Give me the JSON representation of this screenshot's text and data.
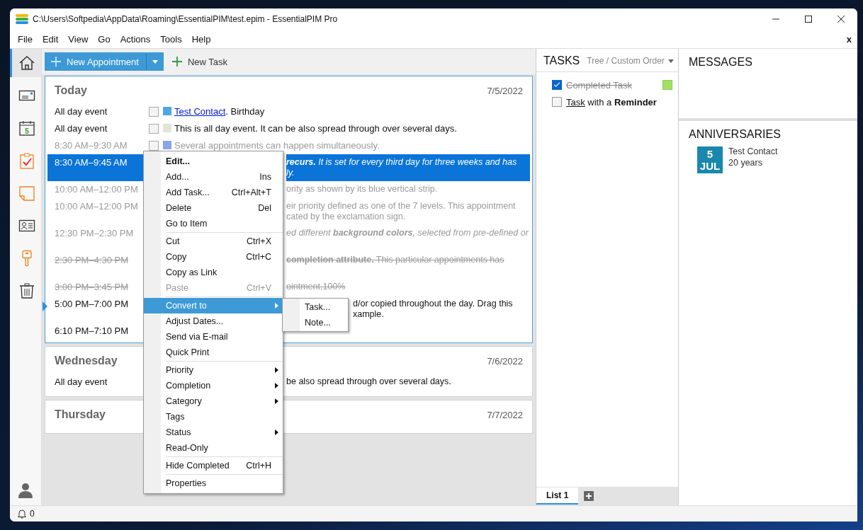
{
  "window": {
    "title": "C:\\Users\\Softpedia\\AppData\\Roaming\\EssentialPIM\\test.epim - EssentialPIM Pro"
  },
  "menu_bar": [
    "File",
    "Edit",
    "View",
    "Go",
    "Actions",
    "Tools",
    "Help"
  ],
  "menu_bar_close": "x",
  "sidebar": {
    "items": [
      {
        "kind": "home",
        "selected": true
      },
      {
        "kind": "mail",
        "selected": false
      },
      {
        "kind": "calendar",
        "selected": false,
        "day": "5"
      },
      {
        "kind": "tasks",
        "selected": false
      },
      {
        "kind": "note",
        "selected": false
      },
      {
        "kind": "contacts",
        "selected": false
      },
      {
        "kind": "key",
        "selected": false
      },
      {
        "kind": "trash",
        "selected": false
      }
    ]
  },
  "toolbar": {
    "new_appointment": "New Appointment",
    "new_task": "New Task"
  },
  "days": [
    {
      "title": "Today",
      "date": "7/5/2022",
      "focused": true,
      "appointments": [
        {
          "time": "All day event",
          "kind": "full",
          "past": false,
          "completed": false,
          "selected": false,
          "current": false,
          "color": "#4ea6e6",
          "link": "Test Contact",
          "text": ". Birthday"
        },
        {
          "time": "All day event",
          "kind": "full",
          "past": false,
          "completed": false,
          "selected": false,
          "current": false,
          "color": "#e4e4d4",
          "text": "This is all day event. It can be also spread through over several days."
        },
        {
          "time": "8:30 AM–9:30 AM",
          "kind": "full",
          "past": true,
          "completed": false,
          "selected": false,
          "current": false,
          "color": "#8ba3e8",
          "text": "Several appointments can happen simultaneously."
        },
        {
          "time": "8:30 AM–9:45 AM",
          "kind": "behind_menu",
          "past": false,
          "completed": false,
          "selected": true,
          "current": false,
          "italic": true,
          "lines": [
            "**recurs.** It is set for every third day for three weeks and has",
            "ly."
          ]
        },
        {
          "time": "10:00 AM–12:00 PM",
          "kind": "behind_menu",
          "past": true,
          "completed": false,
          "selected": false,
          "current": false,
          "lines": [
            "ority as shown by its blue vertical strip."
          ]
        },
        {
          "time": "10:00 AM–12:00 PM",
          "kind": "behind_menu",
          "past": true,
          "completed": false,
          "selected": false,
          "current": false,
          "lines": [
            "eir priority defined as one of the 7 levels. This appointment",
            "cated by the exclamation sign."
          ]
        },
        {
          "time": "12:30 PM–2:30 PM",
          "kind": "behind_menu",
          "past": true,
          "completed": false,
          "selected": false,
          "current": false,
          "italic": true,
          "wraps": true,
          "lines": [
            "ed different **background colors**, selected from pre-defined or"
          ]
        },
        {
          "time": "2:30 PM–4:30 PM",
          "kind": "behind_menu",
          "past": true,
          "completed": true,
          "selected": false,
          "current": false,
          "wraps": true,
          "lines": [
            "**completion attribute.** This particular appointments has"
          ]
        },
        {
          "time": "3:00 PM–3:45 PM",
          "kind": "behind_menu",
          "past": true,
          "completed": true,
          "selected": false,
          "current": false,
          "lines": [
            "ointment,100%"
          ]
        },
        {
          "time": "5:00 PM–7:00 PM",
          "kind": "behind_submenu",
          "past": false,
          "completed": false,
          "selected": false,
          "current": true,
          "lines": [
            "d/or copied throughout the day. Drag this",
            "xample."
          ]
        },
        {
          "time": "6:10 PM–7:10 PM",
          "kind": "hidden",
          "past": false,
          "completed": false,
          "selected": false,
          "current": false
        }
      ]
    },
    {
      "title": "Wednesday",
      "date": "7/6/2022",
      "focused": false,
      "appointments": [
        {
          "time": "All day event",
          "kind": "behind_menu",
          "past": false,
          "completed": false,
          "selected": false,
          "current": false,
          "lines": [
            "be also spread through over several days."
          ]
        }
      ]
    },
    {
      "title": "Thursday",
      "date": "7/7/2022",
      "focused": false
    }
  ],
  "context_menu": {
    "items": [
      {
        "kind": "item",
        "label": "Edit...",
        "bold": true
      },
      {
        "kind": "item",
        "label": "Add...",
        "shortcut": "Ins"
      },
      {
        "kind": "item",
        "label": "Add Task...",
        "shortcut": "Ctrl+Alt+T"
      },
      {
        "kind": "item",
        "label": "Delete",
        "shortcut": "Del"
      },
      {
        "kind": "item",
        "label": "Go to Item"
      },
      {
        "kind": "separator"
      },
      {
        "kind": "item",
        "label": "Cut",
        "shortcut": "Ctrl+X"
      },
      {
        "kind": "item",
        "label": "Copy",
        "shortcut": "Ctrl+C"
      },
      {
        "kind": "item",
        "label": "Copy as Link"
      },
      {
        "kind": "item",
        "label": "Paste",
        "shortcut": "Ctrl+V",
        "disabled": true
      },
      {
        "kind": "separator"
      },
      {
        "kind": "item",
        "label": "Convert to",
        "submenu": true,
        "highlighted": true
      },
      {
        "kind": "item",
        "label": "Adjust Dates..."
      },
      {
        "kind": "item",
        "label": "Send via E-mail"
      },
      {
        "kind": "item",
        "label": "Quick Print"
      },
      {
        "kind": "separator"
      },
      {
        "kind": "item",
        "label": "Priority",
        "submenu": true
      },
      {
        "kind": "item",
        "label": "Completion",
        "submenu": true
      },
      {
        "kind": "item",
        "label": "Category",
        "submenu": true
      },
      {
        "kind": "item",
        "label": "Tags"
      },
      {
        "kind": "item",
        "label": "Status",
        "submenu": true
      },
      {
        "kind": "item",
        "label": "Read-Only"
      },
      {
        "kind": "separator"
      },
      {
        "kind": "item",
        "label": "Hide Completed",
        "shortcut": "Ctrl+H"
      },
      {
        "kind": "separator"
      },
      {
        "kind": "item",
        "label": "Properties"
      }
    ]
  },
  "submenu": {
    "items": [
      "Task...",
      "Note..."
    ]
  },
  "tasks": {
    "title": "TASKS",
    "view": "Tree / Custom Order",
    "items": [
      {
        "checked": true,
        "text": "Completed Task",
        "color": "#a6e060"
      },
      {
        "checked": false,
        "link": "Task",
        "text": " with a **Reminder**"
      }
    ],
    "tabs": [
      {
        "label": "List 1",
        "selected": true
      }
    ]
  },
  "messages": {
    "title": "MESSAGES"
  },
  "anniversaries": {
    "title": "ANNIVERSARIES",
    "items": [
      {
        "day": "5",
        "month": "JUL",
        "name": "Test Contact",
        "years": "20 years"
      }
    ]
  },
  "status_bar": {
    "reminders": "0"
  }
}
